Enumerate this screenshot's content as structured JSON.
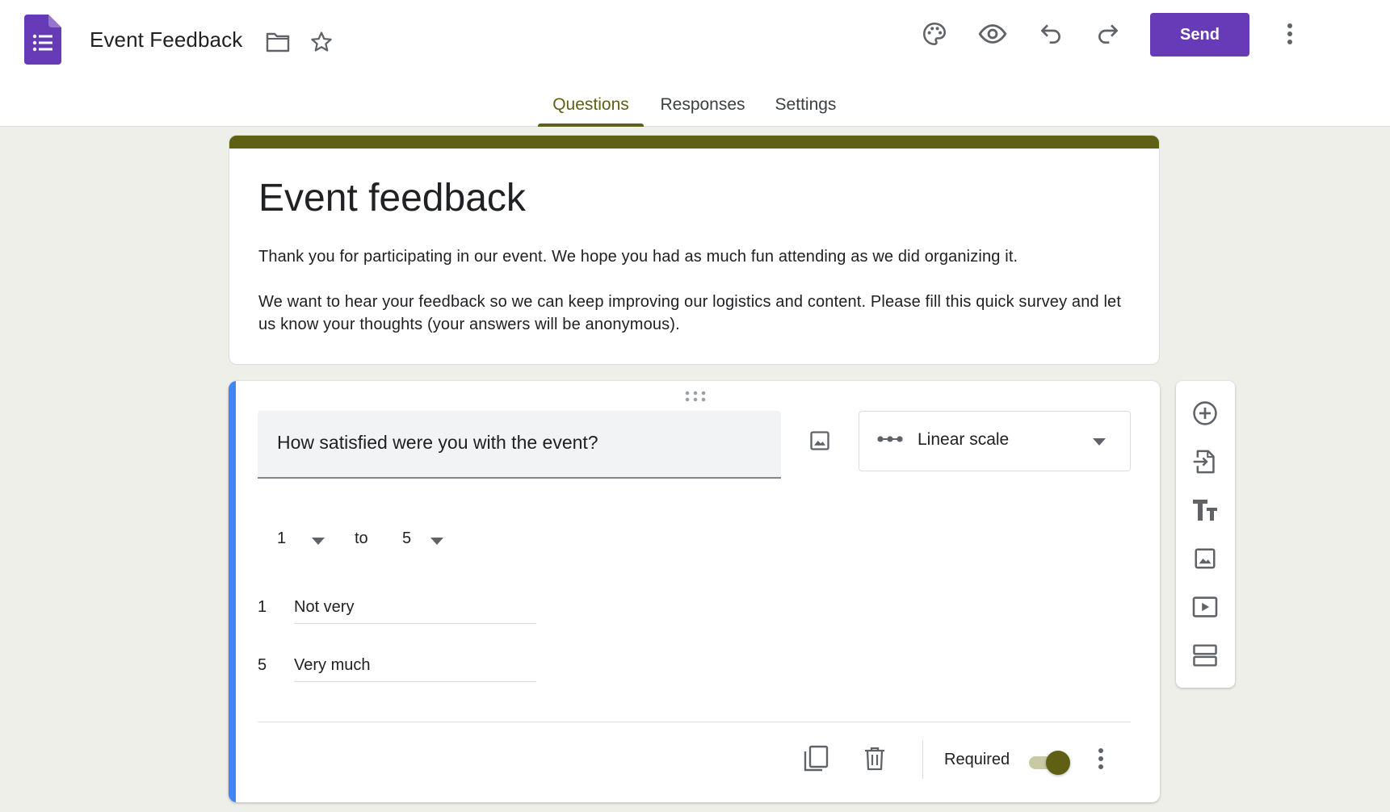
{
  "header": {
    "doc_title": "Event Feedback",
    "send_label": "Send",
    "tabs": [
      {
        "label": "Questions",
        "active": true
      },
      {
        "label": "Responses",
        "active": false
      },
      {
        "label": "Settings",
        "active": false
      }
    ],
    "icons": [
      "folder-icon",
      "star-icon",
      "palette-icon",
      "preview-icon",
      "undo-icon",
      "redo-icon",
      "more-vert-icon"
    ]
  },
  "form": {
    "title": "Event feedback",
    "description": [
      "Thank you for participating in our event. We hope you had as much fun attending as we did organizing it.",
      "We want to hear your feedback so we can keep improving our logistics and content. Please fill this quick survey and let us know your thoughts (your answers will be anonymous)."
    ]
  },
  "question": {
    "text": "How satisfied were you with the event?",
    "type": "Linear scale",
    "scale_from": "1",
    "scale_to_word": "to",
    "scale_to": "5",
    "low_label_num": "1",
    "low_label": "Not very",
    "high_label_num": "5",
    "high_label": "Very much",
    "required_label": "Required",
    "required": true
  },
  "side_toolbar": [
    "add-question-icon",
    "import-questions-icon",
    "add-title-icon",
    "add-image-icon",
    "add-video-icon",
    "add-section-icon"
  ],
  "colors": {
    "brand": "#673ab7",
    "theme": "#5f6014",
    "focus_accent": "#4285f4",
    "background": "#efefea"
  }
}
